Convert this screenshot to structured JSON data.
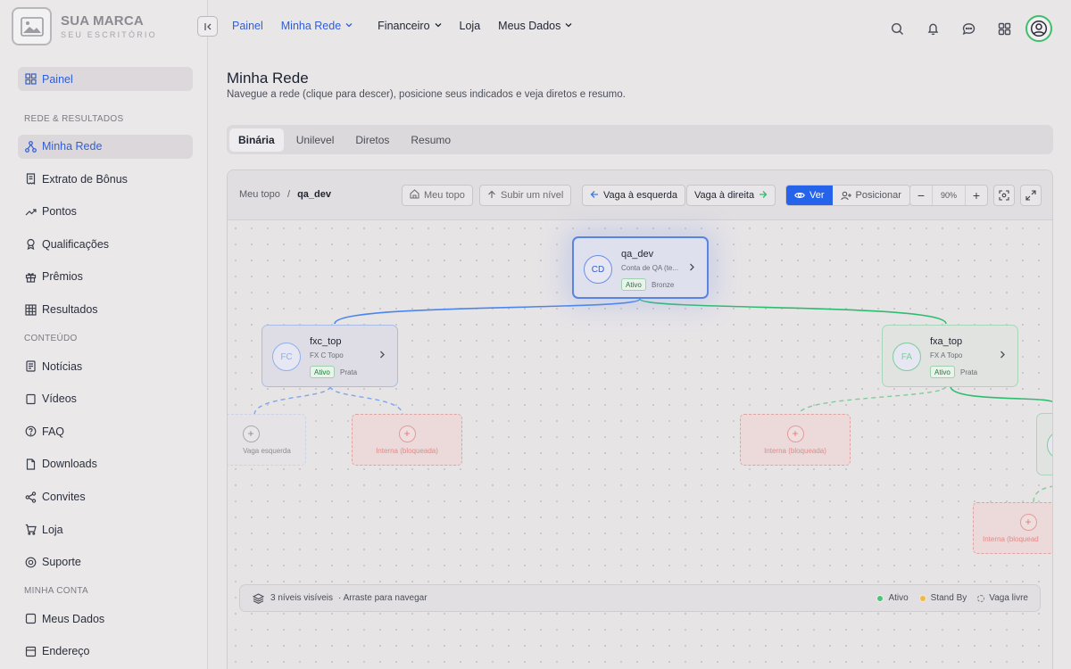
{
  "brand": {
    "name": "SUA MARCA",
    "subtitle": "SEU ESCRITÓRIO"
  },
  "sidebar": {
    "top_item": {
      "label": "Painel",
      "icon": "dashboard-icon"
    },
    "sections": [
      {
        "title": "REDE & RESULTADOS",
        "items": [
          {
            "label": "Minha Rede",
            "icon": "network-icon",
            "active": true
          },
          {
            "label": "Extrato de Bônus",
            "icon": "receipt-icon"
          },
          {
            "label": "Pontos",
            "icon": "trend-icon"
          },
          {
            "label": "Qualificações",
            "icon": "award-icon"
          },
          {
            "label": "Prêmios",
            "icon": "gift-icon"
          },
          {
            "label": "Resultados",
            "icon": "grid-icon"
          }
        ]
      },
      {
        "title": "CONTEÚDO",
        "items": [
          {
            "label": "Notícias",
            "icon": "news-icon"
          },
          {
            "label": "Vídeos",
            "icon": "video-icon"
          },
          {
            "label": "FAQ",
            "icon": "help-icon"
          },
          {
            "label": "Downloads",
            "icon": "file-icon"
          },
          {
            "label": "Convites",
            "icon": "share-icon"
          },
          {
            "label": "Loja",
            "icon": "cart-icon"
          },
          {
            "label": "Suporte",
            "icon": "support-icon"
          }
        ]
      },
      {
        "title": "MINHA CONTA",
        "items": [
          {
            "label": "Meus Dados",
            "icon": "user-icon"
          },
          {
            "label": "Endereço",
            "icon": "address-icon"
          }
        ]
      }
    ]
  },
  "topnav": {
    "items": [
      {
        "label": "Painel",
        "blue": true,
        "chevron": false
      },
      {
        "label": "Minha Rede",
        "blue": true,
        "chevron": true
      },
      {
        "label": "Financeiro",
        "blue": false,
        "chevron": true
      },
      {
        "label": "Loja",
        "blue": false,
        "chevron": false
      },
      {
        "label": "Meus Dados",
        "blue": false,
        "chevron": true
      }
    ]
  },
  "header": {
    "title": "Minha Rede",
    "subtitle": "Navegue a rede (clique para descer), posicione seus indicados e veja diretos e resumo."
  },
  "tabs": [
    "Binária",
    "Unilevel",
    "Diretos",
    "Resumo"
  ],
  "toolbar": {
    "crumb_root": "Meu topo",
    "crumb_sep": "/",
    "crumb_current": "qa_dev",
    "btn_top": "Meu topo",
    "btn_up": "Subir um nível",
    "btn_left": "Vaga à esquerda",
    "btn_right": "Vaga à direita",
    "mode_view": "Ver",
    "mode_place": "Posicionar",
    "zoom_minus": "−",
    "zoom_value": "90%",
    "zoom_plus": "+"
  },
  "tree": {
    "root": {
      "initials": "CD",
      "name": "qa_dev",
      "desc": "Conta de QA (te...",
      "status": "Ativo",
      "rank": "Bronze"
    },
    "left": {
      "initials": "FC",
      "name": "fxc_top",
      "desc": "FX C Topo",
      "status": "Ativo",
      "rank": "Prata"
    },
    "right": {
      "initials": "FA",
      "name": "fxa_top",
      "desc": "FX A Topo",
      "status": "Ativo",
      "rank": "Prata"
    },
    "slots": {
      "free_left": "Vaga esquerda",
      "blocked": "Interna (bloqueada)",
      "blocked_cut": "Interna (bloquead"
    }
  },
  "footer": {
    "levels": "3 níveis visíveis",
    "hint": "· Arraste para navegar",
    "legend": [
      {
        "label": "Ativo",
        "color": "#4cc27a"
      },
      {
        "label": "Stand By",
        "color": "#f0b94a"
      },
      {
        "label": "Vaga livre",
        "color": "dashed"
      }
    ]
  },
  "colors": {
    "accent": "#2f5fd6",
    "active_green": "#3fbf6c",
    "left_line": "#3b7be8",
    "right_line": "#2dbd6e"
  }
}
